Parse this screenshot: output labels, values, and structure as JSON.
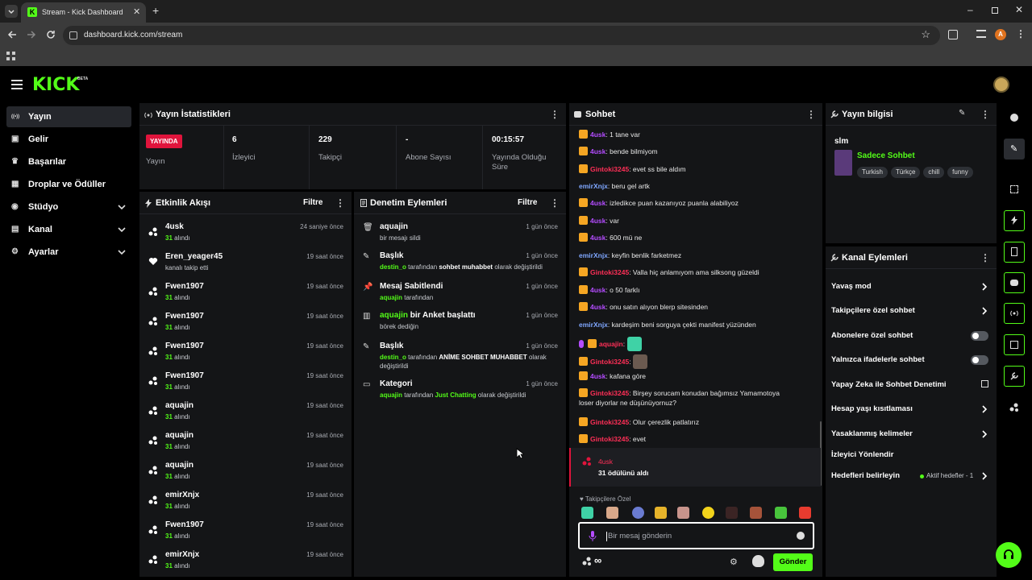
{
  "browser": {
    "tab_title": "Stream - Kick Dashboard",
    "url": "dashboard.kick.com/stream",
    "profile_initial": "A"
  },
  "brand": {
    "logo": "KICK",
    "beta": "BETA"
  },
  "sidebar": {
    "items": [
      {
        "label": "Yayın",
        "icon": "broadcast-icon",
        "active": true
      },
      {
        "label": "Gelir",
        "icon": "money-icon"
      },
      {
        "label": "Başarılar",
        "icon": "trophy-icon"
      },
      {
        "label": "Droplar ve Ödüller",
        "icon": "gift-icon"
      },
      {
        "label": "Stüdyo",
        "icon": "studio-icon",
        "expandable": true
      },
      {
        "label": "Kanal",
        "icon": "channel-icon",
        "expandable": true
      },
      {
        "label": "Ayarlar",
        "icon": "gear-icon",
        "expandable": true
      }
    ]
  },
  "stats": {
    "title": "Yayın İstatistikleri",
    "live_badge": "YAYINDA",
    "live_label": "Yayın",
    "viewers": {
      "value": "6",
      "label": "İzleyici"
    },
    "followers": {
      "value": "229",
      "label": "Takipçi"
    },
    "subs": {
      "value": "-",
      "label": "Abone Sayısı"
    },
    "uptime": {
      "value": "00:15:57",
      "label": "Yayında Olduğu Süre"
    }
  },
  "activity": {
    "title": "Etkinlik Akışı",
    "filter": "Filtre",
    "items": [
      {
        "name": "4usk",
        "detail_green": "31",
        "detail": "alındı",
        "time": "24 saniye önce",
        "icon": "reward-icon"
      },
      {
        "name": "Eren_yeager45",
        "detail_green": "",
        "detail": "kanalı takip etti",
        "time": "19 saat önce",
        "icon": "heart-icon"
      },
      {
        "name": "Fwen1907",
        "detail_green": "31",
        "detail": "alındı",
        "time": "19 saat önce",
        "icon": "reward-icon"
      },
      {
        "name": "Fwen1907",
        "detail_green": "31",
        "detail": "alındı",
        "time": "19 saat önce",
        "icon": "reward-icon"
      },
      {
        "name": "Fwen1907",
        "detail_green": "31",
        "detail": "alındı",
        "time": "19 saat önce",
        "icon": "reward-icon"
      },
      {
        "name": "Fwen1907",
        "detail_green": "31",
        "detail": "alındı",
        "time": "19 saat önce",
        "icon": "reward-icon"
      },
      {
        "name": "aquajin",
        "detail_green": "31",
        "detail": "alındı",
        "time": "19 saat önce",
        "icon": "reward-icon"
      },
      {
        "name": "aquajin",
        "detail_green": "31",
        "detail": "alındı",
        "time": "19 saat önce",
        "icon": "reward-icon"
      },
      {
        "name": "aquajin",
        "detail_green": "31",
        "detail": "alındı",
        "time": "19 saat önce",
        "icon": "reward-icon"
      },
      {
        "name": "emirXnjx",
        "detail_green": "31",
        "detail": "alındı",
        "time": "19 saat önce",
        "icon": "reward-icon"
      },
      {
        "name": "Fwen1907",
        "detail_green": "31",
        "detail": "alındı",
        "time": "19 saat önce",
        "icon": "reward-icon"
      },
      {
        "name": "emirXnjx",
        "detail_green": "31",
        "detail": "alındı",
        "time": "19 saat önce",
        "icon": "reward-icon"
      }
    ]
  },
  "moderation": {
    "title": "Denetim Eylemleri",
    "filter": "Filtre",
    "items": [
      {
        "title": "aquajin",
        "time": "1 gün önce",
        "line1": "bir mesajı sildi",
        "icon": "trash-icon"
      },
      {
        "title": "Başlık",
        "time": "1 gün önce",
        "user": "destin_o",
        "mid": "tarafından",
        "value": "sohbet muhabbet",
        "end": "olarak değiştirildi",
        "icon": "edit-icon"
      },
      {
        "title": "Mesaj Sabitlendi",
        "time": "1 gün önce",
        "user": "aquajin",
        "mid": "tarafından",
        "icon": "pin-icon"
      },
      {
        "title_user": "aquajin",
        "title": "bir Anket başlattı",
        "time": "1 gün önce",
        "line1": "börek dediğin",
        "icon": "poll-icon"
      },
      {
        "title": "Başlık",
        "time": "1 gün önce",
        "user": "destin_o",
        "mid": "tarafından",
        "value": "ANİME SOHBET MUHABBET",
        "end": "olarak",
        "end2": "değiştirildi",
        "icon": "edit-icon"
      },
      {
        "title": "Kategori",
        "time": "1 gün önce",
        "user": "aquajin",
        "mid": "tarafından",
        "value_green": "Just Chatting",
        "end": "olarak değiştirildi",
        "icon": "category-icon"
      }
    ]
  },
  "chat": {
    "title": "Sohbet",
    "messages": [
      {
        "user": "4usk",
        "color": "purple",
        "crown": true,
        "text": "1 tane var"
      },
      {
        "user": "4usk",
        "color": "purple",
        "crown": true,
        "text": "bende bilmiyom"
      },
      {
        "user": "Gintoki3245",
        "color": "red",
        "crown": true,
        "text": "evet ss bile aldım"
      },
      {
        "user": "emirXnjx",
        "color": "blue",
        "crown": false,
        "text": "beru gel artk"
      },
      {
        "user": "4usk",
        "color": "purple",
        "crown": true,
        "text": "izledikce puan kazanıyoz puanla alabiliyoz"
      },
      {
        "user": "4usk",
        "color": "purple",
        "crown": true,
        "text": "var"
      },
      {
        "user": "4usk",
        "color": "purple",
        "crown": true,
        "text": "600 mü ne"
      },
      {
        "user": "emirXnjx",
        "color": "blue",
        "crown": false,
        "text": "keyfin benlik farketmez"
      },
      {
        "user": "Gintoki3245",
        "color": "red",
        "crown": true,
        "text": "Valla hiç anlamıyom ama silksong güzeldi"
      },
      {
        "user": "4usk",
        "color": "purple",
        "crown": true,
        "text": "o 50 farklı"
      },
      {
        "user": "4usk",
        "color": "purple",
        "crown": true,
        "text": "onu satın alıyon blerp sitesinden"
      },
      {
        "user": "emirXnjx",
        "color": "blue",
        "crown": false,
        "text": "kardeşim beni sorguya çekti manifest yüzünden"
      },
      {
        "user": "aquajin",
        "color": "red",
        "crown": true,
        "text": "",
        "emote": true,
        "mod": true
      },
      {
        "user": "Gintoki3245",
        "color": "red",
        "crown": true,
        "text": "",
        "emote": true
      },
      {
        "user": "4usk",
        "color": "purple",
        "crown": true,
        "text": "kafana göre"
      },
      {
        "user": "Gintoki3245",
        "color": "red",
        "crown": true,
        "text": "Birşey sorucam konudan bağımsız Yamamotoya",
        "text2": "loser diyorlar ne düşünüyornuz?"
      },
      {
        "user": "Gintoki3245",
        "color": "red",
        "crown": true,
        "text": "Olur çerezlik patlatırız"
      },
      {
        "user": "Gintoki3245",
        "color": "red",
        "crown": true,
        "text": "evet"
      }
    ],
    "reward": {
      "user": "4usk",
      "text": "31 ödülünü aldı"
    },
    "followers_only": "Takipçilere Özel",
    "input_placeholder": "Bir mesaj gönderin",
    "infinity": "∞",
    "send": "Gönder"
  },
  "stream_info": {
    "title": "Yayın bilgisi",
    "stream_title": "slm",
    "category": "Sadece Sohbet",
    "tags": [
      "Turkish",
      "Türkçe",
      "chill",
      "funny"
    ]
  },
  "channel_actions": {
    "title": "Kanal Eylemleri",
    "rows": [
      {
        "label": "Yavaş mod",
        "kind": "chevron"
      },
      {
        "label": "Takipçilere özel sohbet",
        "kind": "chevron"
      },
      {
        "label": "Abonelere özel sohbet",
        "kind": "toggle",
        "on": false
      },
      {
        "label": "Yalnızca ifadelerle sohbet",
        "kind": "toggle",
        "on": false
      },
      {
        "label": "Yapay Zeka ile Sohbet Denetimi",
        "kind": "external"
      },
      {
        "label": "Hesap yaşı kısıtlaması",
        "kind": "chevron"
      },
      {
        "label": "Yasaklanmış kelimeler",
        "kind": "chevron"
      },
      {
        "label": "İzleyici Yönlendir",
        "kind": "none"
      },
      {
        "label": "Hedefleri belirleyin",
        "kind": "goals",
        "status": "Aktif hedefler - 1"
      }
    ]
  },
  "colors": {
    "accent": "#53fc18",
    "live": "#e0143c",
    "panel": "#141517",
    "bg": "#000000"
  }
}
